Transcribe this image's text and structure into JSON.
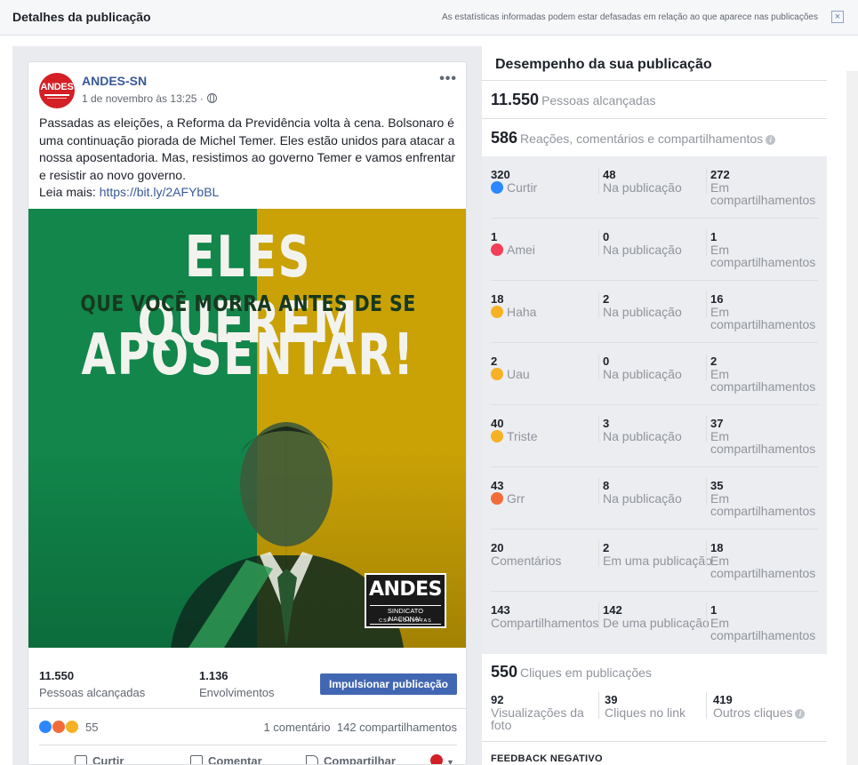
{
  "dialog": {
    "title": "Detalhes da publicação",
    "note": "As estatísticas informadas podem estar defasadas em relação ao que aparece nas publicações",
    "close_glyph": "×"
  },
  "post": {
    "avatar_text": "ANDES",
    "page_name": "ANDES-SN",
    "date": "1 de novembro às 13:25 ·",
    "more_glyph": "•••",
    "text_lines": [
      "Passadas as eleições, a Reforma da Previdência volta à cena. Bolsonaro é",
      "uma continuação piorada de Michel Temer. Eles estão unidos para atacar a",
      "nossa aposentadoria. Mas, resistimos ao governo Temer e vamos enfrentar",
      "e resistir ao novo governo."
    ],
    "read_more_label": "Leia mais:",
    "link": "https://bit.ly/2AFYbBL",
    "image": {
      "line1": "ELES QUEREM",
      "line2": "QUE VOCÊ MORRA ANTES DE SE",
      "line3": "APOSENTAR!",
      "logo_main": "ANDES",
      "logo_sub": "SINDICATO NACIONAL",
      "logo_sub2": "CSP · CONLUTAS"
    },
    "stats": {
      "reach_num": "11.550",
      "reach_label": "Pessoas alcançadas",
      "engage_num": "1.136",
      "engage_label": "Envolvimentos",
      "boost_label": "Impulsionar publicação"
    },
    "reactions": {
      "count": "55",
      "comments": "1 comentário",
      "shares": "142 compartilhamentos"
    },
    "actions": {
      "like": "Curtir",
      "comment": "Comentar",
      "share": "Compartilhar"
    }
  },
  "performance": {
    "title": "Desempenho da sua publicação",
    "reach_num": "11.550",
    "reach_label": "Pessoas alcançadas",
    "reactions_num": "586",
    "reactions_label": "Reações, comentários e compartilhamentos",
    "rows": [
      {
        "total": "320",
        "label": "Curtir",
        "icon": "like-icon",
        "on_post": "48",
        "on_post_label": "Na publicação",
        "on_shares": "272",
        "on_shares_label": "Em compartilhamentos"
      },
      {
        "total": "1",
        "label": "Amei",
        "icon": "love-icon",
        "on_post": "0",
        "on_post_label": "Na publicação",
        "on_shares": "1",
        "on_shares_label": "Em compartilhamentos"
      },
      {
        "total": "18",
        "label": "Haha",
        "icon": "haha-icon",
        "on_post": "2",
        "on_post_label": "Na publicação",
        "on_shares": "16",
        "on_shares_label": "Em compartilhamentos"
      },
      {
        "total": "2",
        "label": "Uau",
        "icon": "wow-icon",
        "on_post": "0",
        "on_post_label": "Na publicação",
        "on_shares": "2",
        "on_shares_label": "Em compartilhamentos"
      },
      {
        "total": "40",
        "label": "Triste",
        "icon": "sad-icon",
        "on_post": "3",
        "on_post_label": "Na publicação",
        "on_shares": "37",
        "on_shares_label": "Em compartilhamentos"
      },
      {
        "total": "43",
        "label": "Grr",
        "icon": "angry-icon",
        "on_post": "8",
        "on_post_label": "Na publicação",
        "on_shares": "35",
        "on_shares_label": "Em compartilhamentos"
      },
      {
        "total": "20",
        "label": "Comentários",
        "icon": "",
        "on_post": "2",
        "on_post_label": "Em uma publicação",
        "on_shares": "18",
        "on_shares_label": "Em compartilhamentos"
      },
      {
        "total": "143",
        "label": "Compartilhamentos",
        "icon": "",
        "on_post": "142",
        "on_post_label": "De uma publicação",
        "on_shares": "1",
        "on_shares_label": "Em compartilhamentos"
      }
    ],
    "clicks_num": "550",
    "clicks_label": "Cliques em publicações",
    "clicks": [
      {
        "num": "92",
        "label": "Visualizações da foto"
      },
      {
        "num": "39",
        "label": "Cliques no link"
      },
      {
        "num": "419",
        "label": "Outros cliques"
      }
    ],
    "negative_feedback_title": "FEEDBACK NEGATIVO"
  },
  "colors": {
    "like": "#2d88ff",
    "love": "#f33e58",
    "emoji": "#f7b125",
    "brand_blue": "#4267b2",
    "andes_red": "#d41f26"
  }
}
